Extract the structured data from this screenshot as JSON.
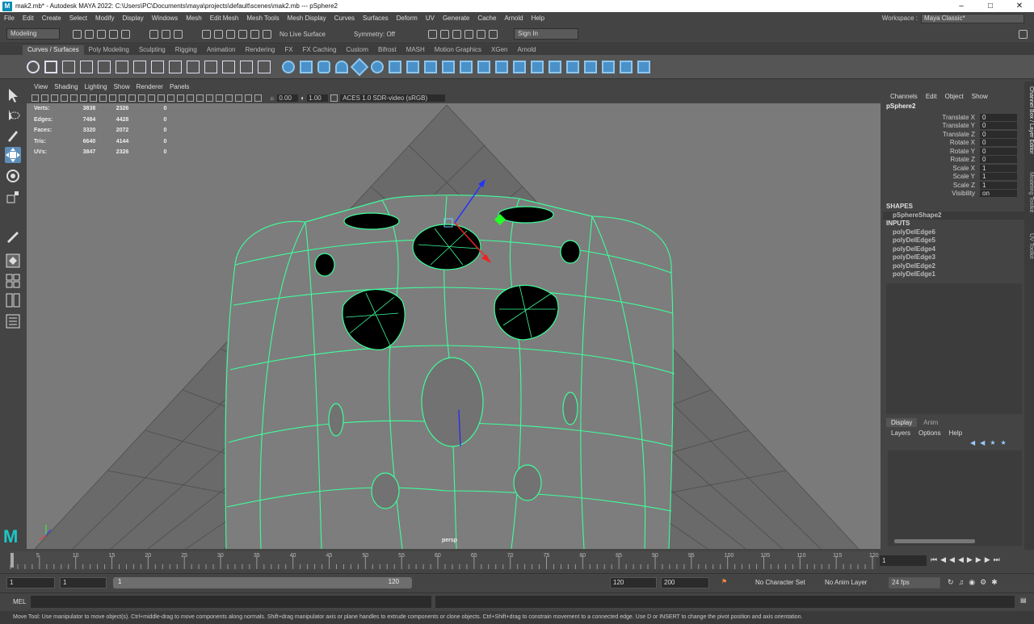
{
  "window": {
    "title": "mak2.mb* - Autodesk MAYA 2022: C:\\Users\\PC\\Documents\\maya\\projects\\default\\scenes\\mak2.mb   ---   pSphere2",
    "logo": "M"
  },
  "menu": {
    "items": [
      "File",
      "Edit",
      "Create",
      "Select",
      "Modify",
      "Display",
      "Windows",
      "Mesh",
      "Edit Mesh",
      "Mesh Tools",
      "Mesh Display",
      "Curves",
      "Surfaces",
      "Deform",
      "UV",
      "Generate",
      "Cache",
      "Arnold",
      "Help"
    ],
    "workspace_label": "Workspace :",
    "workspace_value": "Maya Classic*"
  },
  "status": {
    "mode": "Modeling",
    "live_surface": "No Live Surface",
    "symmetry": "Symmetry: Off",
    "sign_in": "Sign In"
  },
  "shelf_tabs": [
    "Curves / Surfaces",
    "Poly Modeling",
    "Sculpting",
    "Rigging",
    "Animation",
    "Rendering",
    "FX",
    "FX Caching",
    "Custom",
    "Bifrost",
    "MASH",
    "Motion Graphics",
    "XGen",
    "Arnold"
  ],
  "viewport": {
    "menu": [
      "View",
      "Shading",
      "Lighting",
      "Show",
      "Renderer",
      "Panels"
    ],
    "exposure": "0.00",
    "gamma": "1.00",
    "color_space": "ACES 1.0 SDR-video (sRGB)",
    "camera_label": "persp",
    "hud": [
      {
        "label": "Verts:",
        "a": "3838",
        "b": "2326",
        "c": "0"
      },
      {
        "label": "Edges:",
        "a": "7484",
        "b": "4428",
        "c": "0"
      },
      {
        "label": "Faces:",
        "a": "3320",
        "b": "2072",
        "c": "0"
      },
      {
        "label": "Tris:",
        "a": "6640",
        "b": "4144",
        "c": "0"
      },
      {
        "label": "UVs:",
        "a": "3847",
        "b": "2326",
        "c": "0"
      }
    ],
    "wire_color": "#3dff9a"
  },
  "channel_box": {
    "menu": [
      "Channels",
      "Edit",
      "Object",
      "Show"
    ],
    "object": "pSphere2",
    "attrs": [
      {
        "name": "Translate X",
        "value": "0"
      },
      {
        "name": "Translate Y",
        "value": "0"
      },
      {
        "name": "Translate Z",
        "value": "0"
      },
      {
        "name": "Rotate X",
        "value": "0"
      },
      {
        "name": "Rotate Y",
        "value": "0"
      },
      {
        "name": "Rotate Z",
        "value": "0"
      },
      {
        "name": "Scale X",
        "value": "1"
      },
      {
        "name": "Scale Y",
        "value": "1"
      },
      {
        "name": "Scale Z",
        "value": "1"
      },
      {
        "name": "Visibility",
        "value": "on"
      }
    ],
    "shapes_header": "SHAPES",
    "shape": "pSphereShape2",
    "inputs_header": "INPUTS",
    "inputs": [
      "polyDelEdge6",
      "polyDelEdge5",
      "polyDelEdge4",
      "polyDelEdge3",
      "polyDelEdge2",
      "polyDelEdge1"
    ]
  },
  "side_tabs": [
    "Channel Box / Layer Editor",
    "Modeling Toolkit",
    "UV Toolkit"
  ],
  "layer_editor": {
    "tabs": [
      "Display",
      "Anim"
    ],
    "menu": [
      "Layers",
      "Options",
      "Help"
    ]
  },
  "time": {
    "ticks": [
      "5",
      "10",
      "15",
      "20",
      "25",
      "30",
      "35",
      "40",
      "45",
      "50",
      "55",
      "60",
      "65",
      "70",
      "75",
      "80",
      "85",
      "90",
      "95",
      "100",
      "105",
      "110",
      "115",
      "120"
    ],
    "current": "1",
    "start": "1",
    "range_start": "1",
    "range_slider_start": "1",
    "range_slider_end": "120",
    "range_end": "120",
    "end": "200",
    "character_set": "No Character Set",
    "anim_layer": "No Anim Layer",
    "fps": "24 fps"
  },
  "command": {
    "lang": "MEL"
  },
  "help_line": "Move Tool: Use manipulator to move object(s). Ctrl+middle-drag to move components along normals. Shift+drag manipulator axis or plane handles to extrude components or clone objects. Ctrl+Shift+drag to constrain movement to a connected edge. Use D or INSERT to change the pivot position and axis orientation."
}
